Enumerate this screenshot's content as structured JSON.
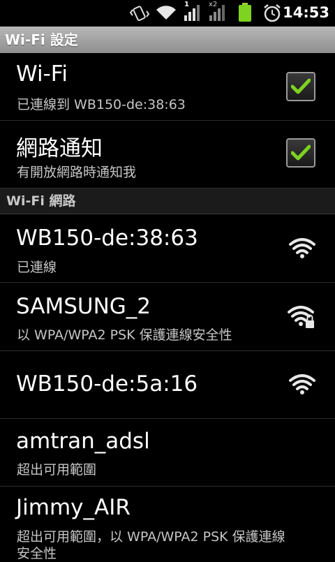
{
  "status_bar": {
    "time": "14:53",
    "signal_1_label": "1",
    "signal_2_label": "x2",
    "icons": [
      "vibrate-icon",
      "wifi-status-icon",
      "signal-icon",
      "signal-icon",
      "battery-icon",
      "alarm-icon"
    ],
    "battery_color": "#7ed321"
  },
  "header": {
    "title": "Wi-Fi 設定"
  },
  "settings": [
    {
      "title": "Wi-Fi",
      "summary": "已連線到 WB150-de:38:63",
      "checked": true
    },
    {
      "title": "網路通知",
      "summary": "有開放網路時通知我",
      "checked": true
    }
  ],
  "section_header": "Wi-Fi 網路",
  "networks": [
    {
      "ssid": "WB150-de:38:63",
      "summary": "已連線",
      "icon": "wifi-signal-icon"
    },
    {
      "ssid": "SAMSUNG_2",
      "summary": "以 WPA/WPA2 PSK 保護連線安全性",
      "icon": "wifi-locked-icon"
    },
    {
      "ssid": "WB150-de:5a:16",
      "summary": "",
      "icon": "wifi-signal-icon"
    },
    {
      "ssid": "amtran_adsl",
      "summary": "超出可用範圍",
      "icon": ""
    },
    {
      "ssid": "Jimmy_AIR",
      "summary": "超出可用範圍，以 WPA/WPA2 PSK 保護連線",
      "summary_line2": "安全性",
      "icon": ""
    }
  ],
  "colors": {
    "checkmark": "#7ed321",
    "title_bar": "#a4a4a4",
    "summary_text": "#c6c6c6"
  }
}
